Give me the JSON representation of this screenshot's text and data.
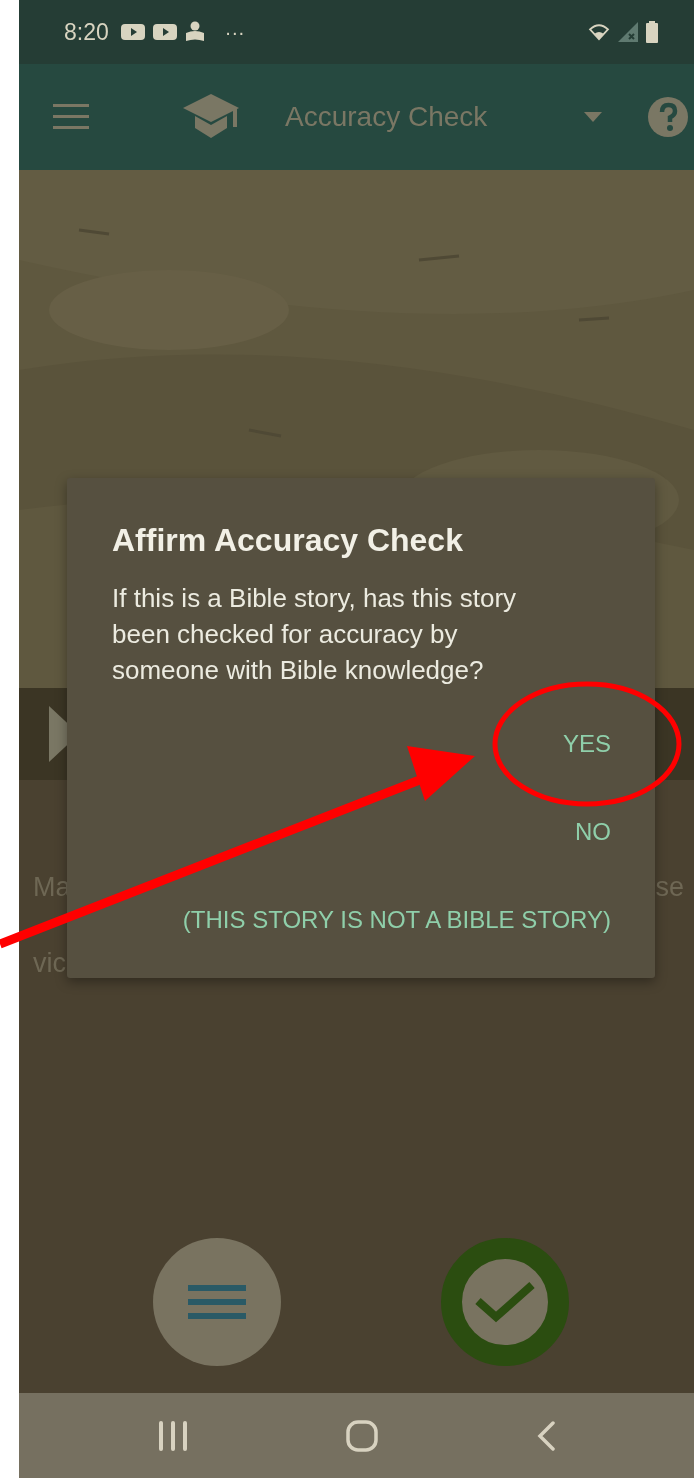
{
  "status_bar": {
    "time": "8:20",
    "more": "···"
  },
  "app_bar": {
    "title": "Accuracy Check"
  },
  "description_lines": [
    {
      "left": "Ma",
      "right": "se"
    },
    {
      "left": "vic"
    }
  ],
  "dialog": {
    "title": "Affirm Accuracy Check",
    "message": "If this is a Bible story, has this story been checked for accuracy by someone with Bible knowledge?",
    "buttons": [
      {
        "label": "YES",
        "highlighted": true
      },
      {
        "label": "NO",
        "highlighted": false
      },
      {
        "label": "(THIS STORY IS NOT A BIBLE STORY)",
        "highlighted": false
      }
    ]
  }
}
